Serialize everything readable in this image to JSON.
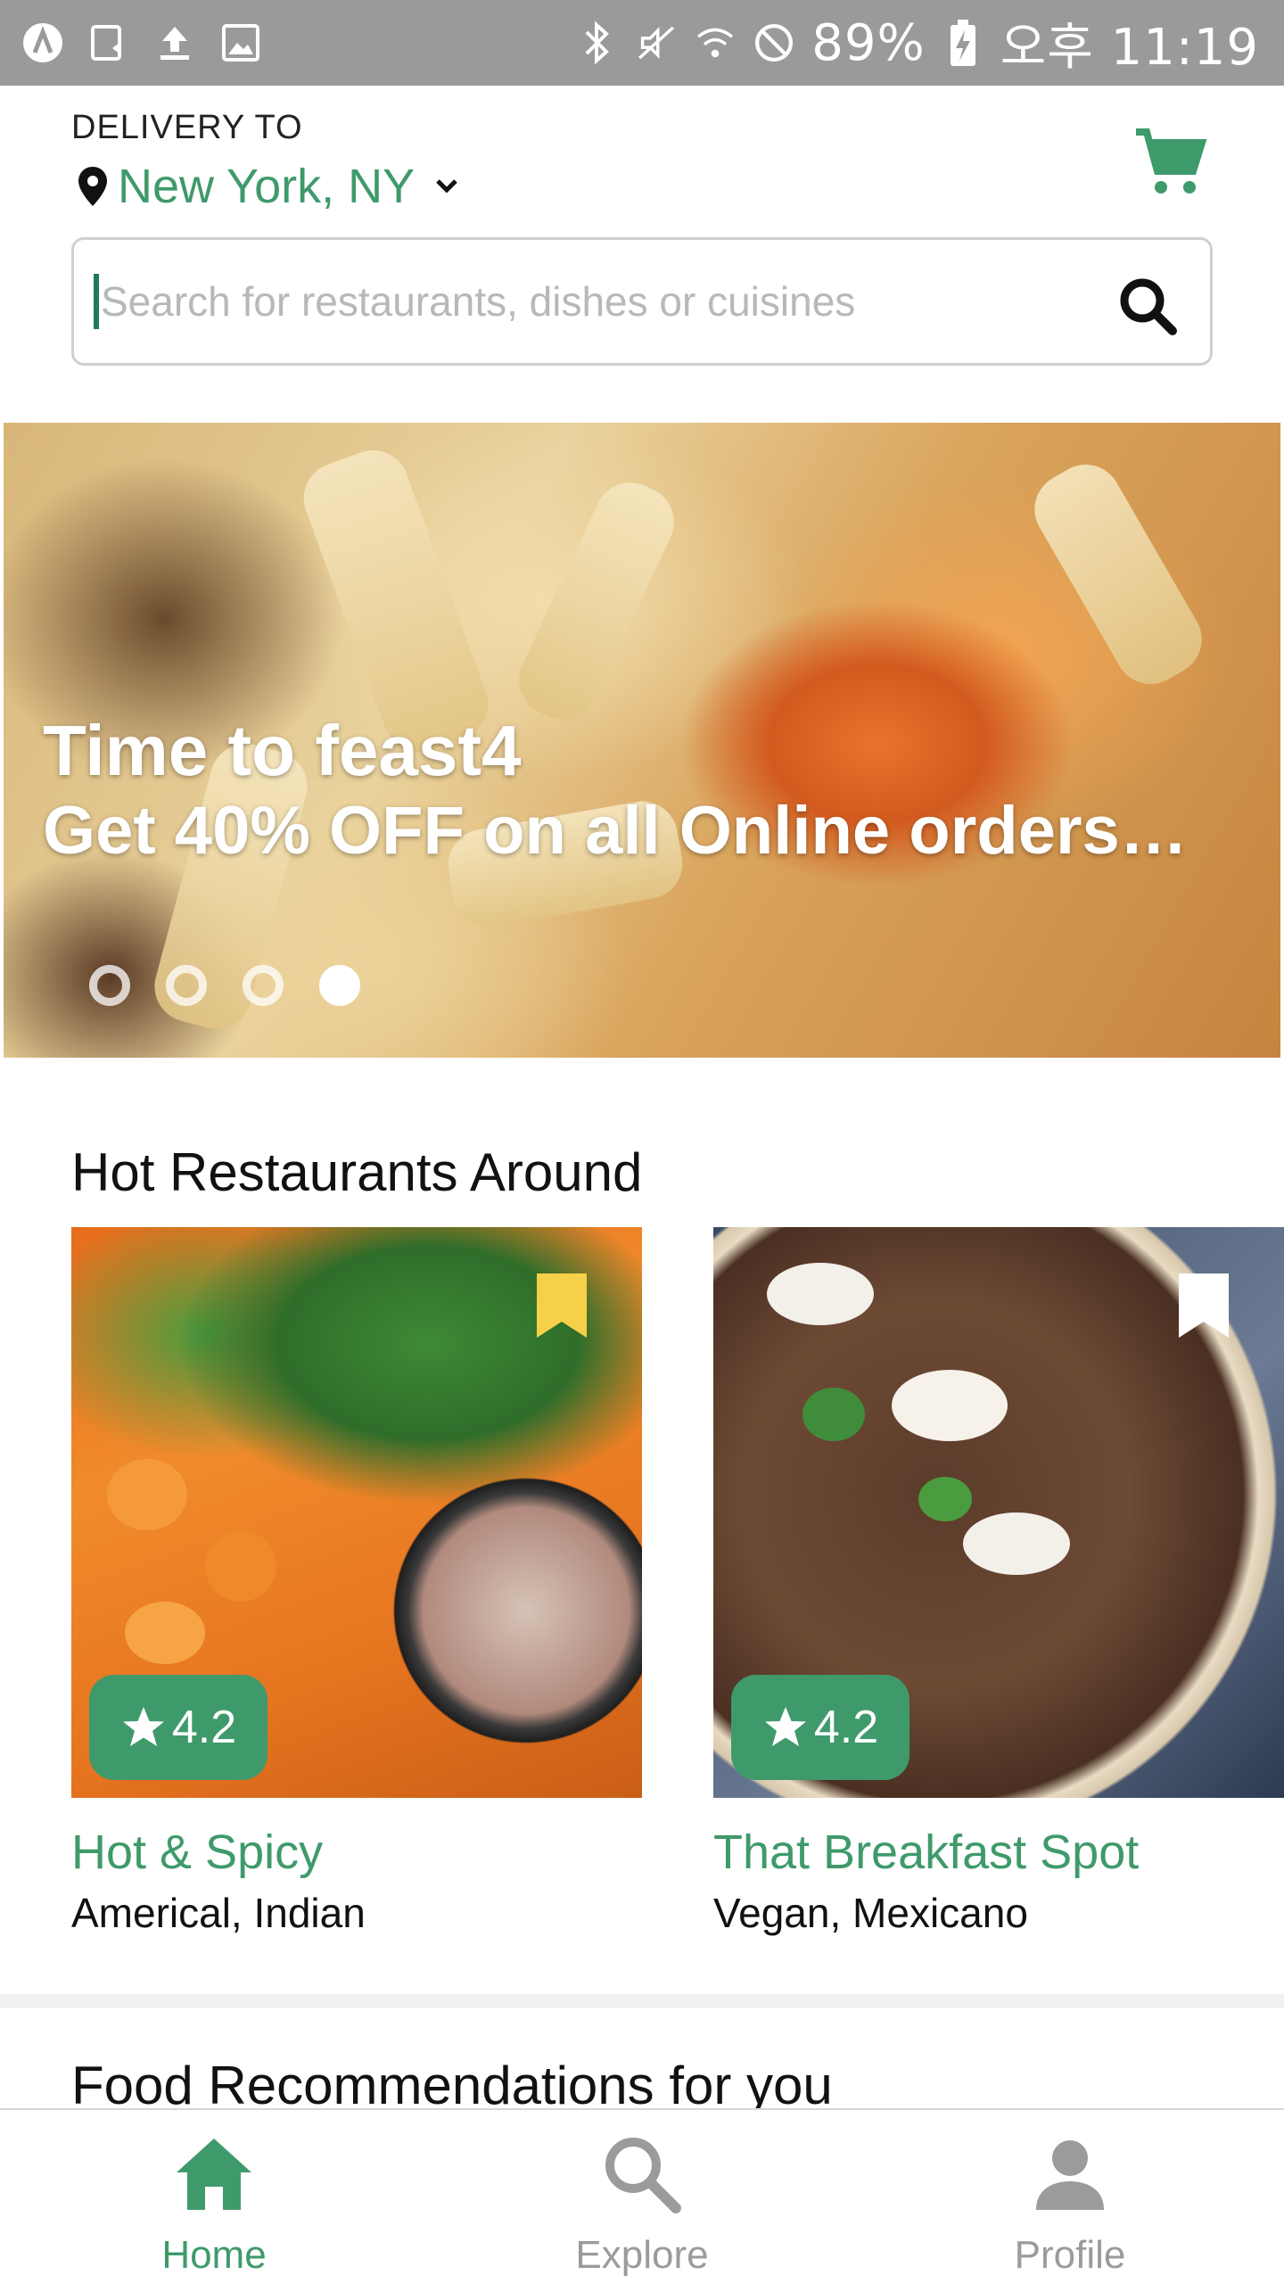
{
  "status_bar": {
    "battery": "89%",
    "time_label": "오후 11:19"
  },
  "header": {
    "delivery_label": "DELIVERY TO",
    "location": "New York, NY"
  },
  "search": {
    "placeholder": "Search for restaurants, dishes or cuisines",
    "value": ""
  },
  "banner": {
    "title": "Time to feast4",
    "subtitle": "Get 40% OFF on all Online orders…",
    "slide_count": 4,
    "active_slide": 4
  },
  "hot_restaurants": {
    "title": "Hot Restaurants Around",
    "items": [
      {
        "name": "Hot & Spicy",
        "cuisine": "Americal, Indian",
        "rating": "4.2",
        "bookmarked": true
      },
      {
        "name": "That Breakfast Spot",
        "cuisine": "Vegan, Mexicano",
        "rating": "4.2",
        "bookmarked": false
      }
    ]
  },
  "recommendations": {
    "title": "Food Recommendations for you"
  },
  "bottom_nav": {
    "items": [
      {
        "label": "Home",
        "icon": "home-icon",
        "active": true
      },
      {
        "label": "Explore",
        "icon": "search-icon",
        "active": false
      },
      {
        "label": "Profile",
        "icon": "person-icon",
        "active": false
      }
    ]
  },
  "colors": {
    "accent": "#3f9a6b",
    "bookmark_active": "#f7d04a",
    "status_bar": "#9a9a9a"
  }
}
